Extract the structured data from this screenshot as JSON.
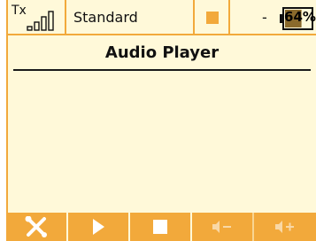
{
  "status_bar": {
    "tx_label": "Tx",
    "model_name": "Standard",
    "battery_separator": "-",
    "battery_level": 0.64,
    "battery_text": "64%"
  },
  "header": {
    "title": "Audio Player"
  },
  "toolbar": {
    "buttons": [
      {
        "icon": "tools-icon",
        "enabled": true
      },
      {
        "icon": "play-icon",
        "enabled": true
      },
      {
        "icon": "stop-icon",
        "enabled": true
      },
      {
        "icon": "volume-down-icon",
        "enabled": false
      },
      {
        "icon": "volume-up-icon",
        "enabled": false
      }
    ]
  },
  "colors": {
    "accent": "#f2a93b",
    "background": "#fff9d9",
    "text": "#111111",
    "battery_fill": "#8a6a2c"
  }
}
